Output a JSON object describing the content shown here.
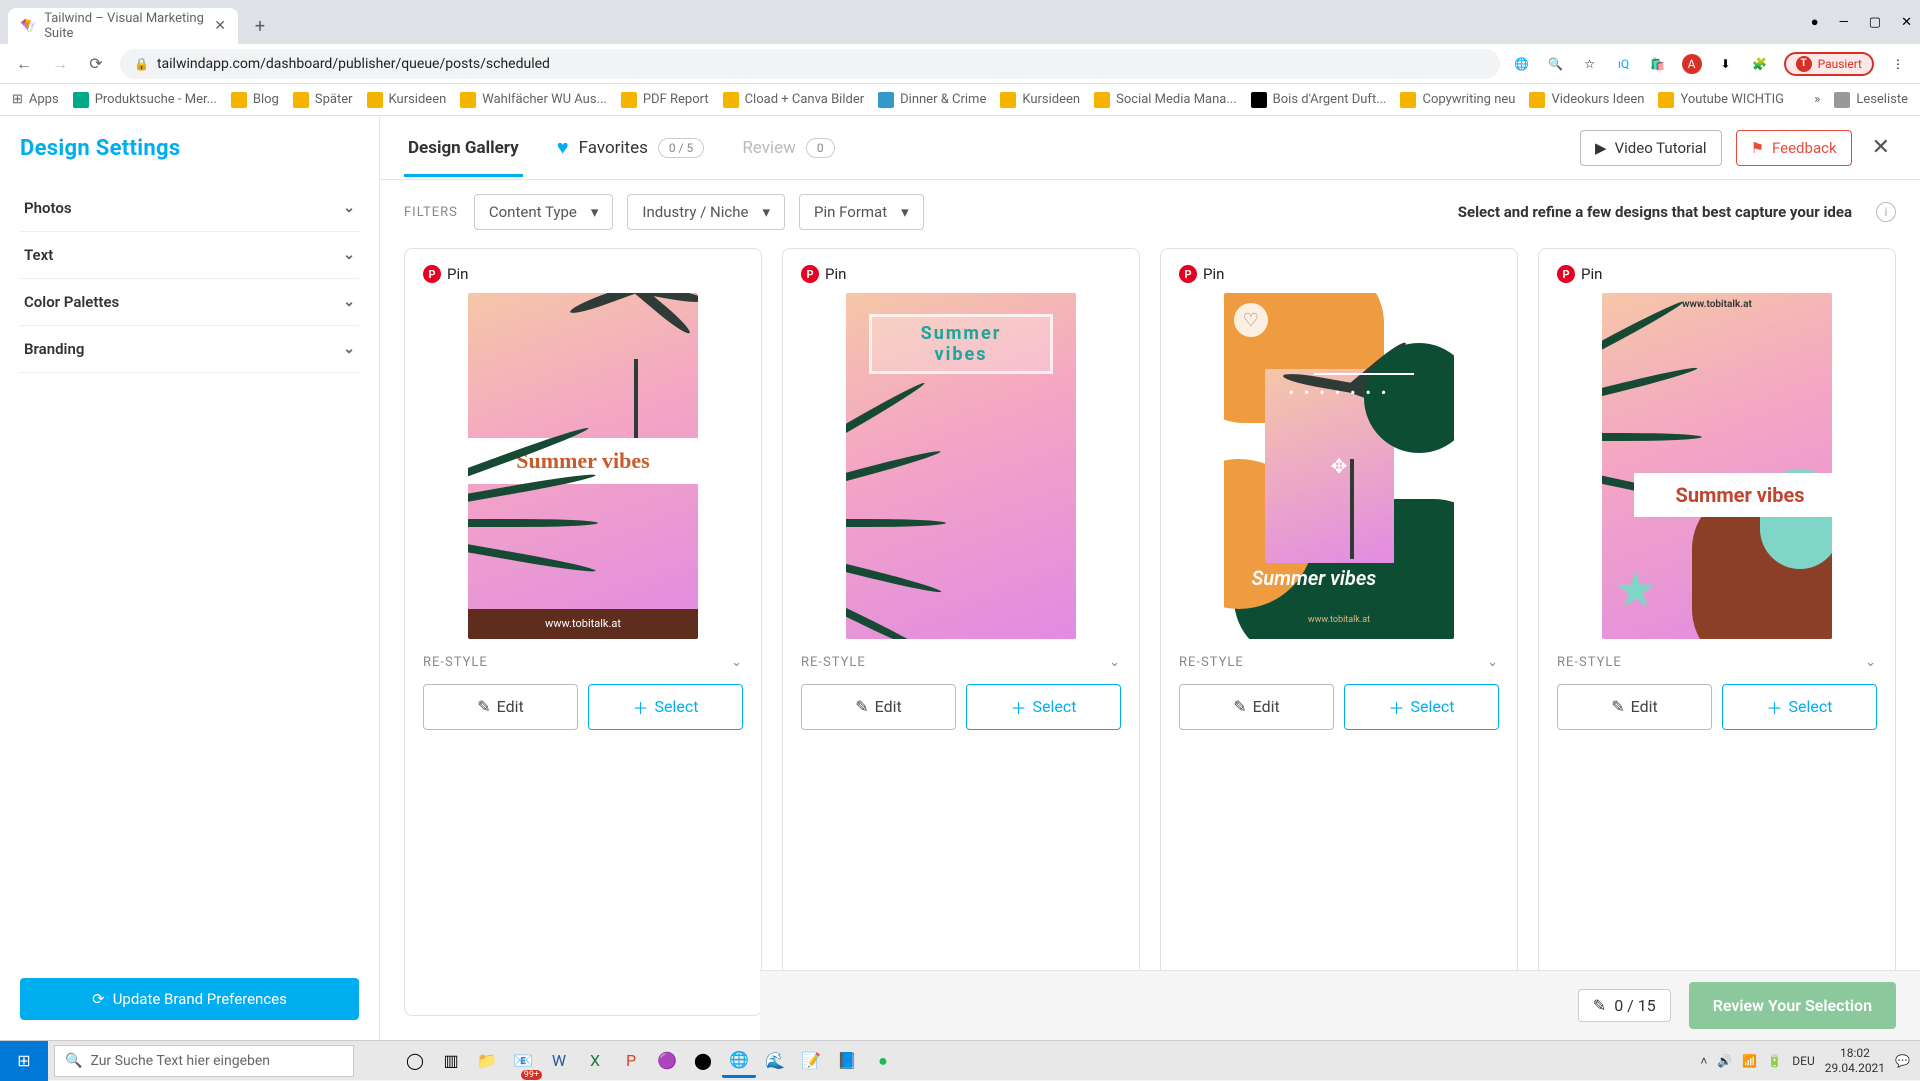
{
  "browser": {
    "tab_title": "Tailwind – Visual Marketing Suite",
    "url": "tailwindapp.com/dashboard/publisher/queue/posts/scheduled",
    "pause_label": "Pausiert",
    "bookmarks": [
      "Apps",
      "Produktsuche - Mer...",
      "Blog",
      "Später",
      "Kursideen",
      "Wahlfächer WU Aus...",
      "PDF Report",
      "Cload + Canva Bilder",
      "Dinner & Crime",
      "Kursideen",
      "Social Media Mana...",
      "Bois d'Argent Duft...",
      "Copywriting neu",
      "Videokurs Ideen",
      "Youtube WICHTIG",
      "Leseliste"
    ]
  },
  "sidebar": {
    "title": "Design Settings",
    "items": [
      "Photos",
      "Text",
      "Color Palettes",
      "Branding"
    ],
    "update_btn": "Update Brand Preferences"
  },
  "topTabs": {
    "gallery": "Design Gallery",
    "favorites": "Favorites",
    "fav_count": "0 / 5",
    "review": "Review",
    "review_count": "0",
    "video": "Video Tutorial",
    "feedback": "Feedback"
  },
  "filters": {
    "label": "FILTERS",
    "contentType": "Content Type",
    "industry": "Industry / Niche",
    "pinFormat": "Pin Format",
    "hint": "Select and refine a few designs that best capture your idea"
  },
  "cards": {
    "pin": "Pin",
    "restyle": "RE-STYLE",
    "edit": "Edit",
    "select": "Select",
    "t1_title": "Summer vibes",
    "t1_url": "www.tobitalk.at",
    "t2_line1": "Summer",
    "t2_line2": "vibes",
    "t3_title": "Summer vibes",
    "t3_url": "www.tobitalk.at",
    "t4_title": "Summer vibes",
    "t4_url": "www.tobitalk.at"
  },
  "bottom": {
    "counter": "0 / 15",
    "review_btn": "Review Your Selection"
  },
  "taskbar": {
    "search_placeholder": "Zur Suche Text hier eingeben",
    "lang": "DEU",
    "time": "18:02",
    "date": "29.04.2021",
    "chrome_badge": "99+"
  }
}
